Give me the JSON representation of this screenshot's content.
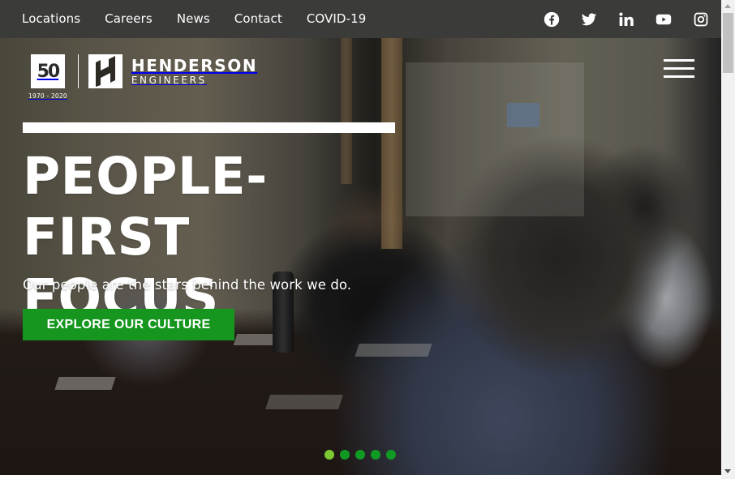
{
  "topbar": {
    "nav": [
      {
        "label": "Locations"
      },
      {
        "label": "Careers"
      },
      {
        "label": "News"
      },
      {
        "label": "Contact"
      },
      {
        "label": "COVID-19"
      }
    ],
    "social": [
      {
        "name": "facebook-icon"
      },
      {
        "name": "twitter-icon"
      },
      {
        "name": "linkedin-icon"
      },
      {
        "name": "youtube-icon"
      },
      {
        "name": "instagram-icon"
      }
    ],
    "background": "#3b3b3a"
  },
  "logo": {
    "anniversary_number": "50",
    "anniversary_years": "1970 - 2020",
    "company_name": "HENDERSON",
    "company_sub": "ENGINEERS"
  },
  "hero": {
    "headline_line1": "PEOPLE-FIRST",
    "headline_line2": "FOCUS",
    "subhead": "Our people are the stars behind the work we do.",
    "cta_label": "EXPLORE OUR CULTURE",
    "cta_color": "#16961f",
    "slides_total": 5,
    "active_slide": 1,
    "dot_active_color": "#7ec832",
    "dot_color": "#119a23"
  },
  "menu": {
    "icon": "hamburger-menu-icon"
  }
}
